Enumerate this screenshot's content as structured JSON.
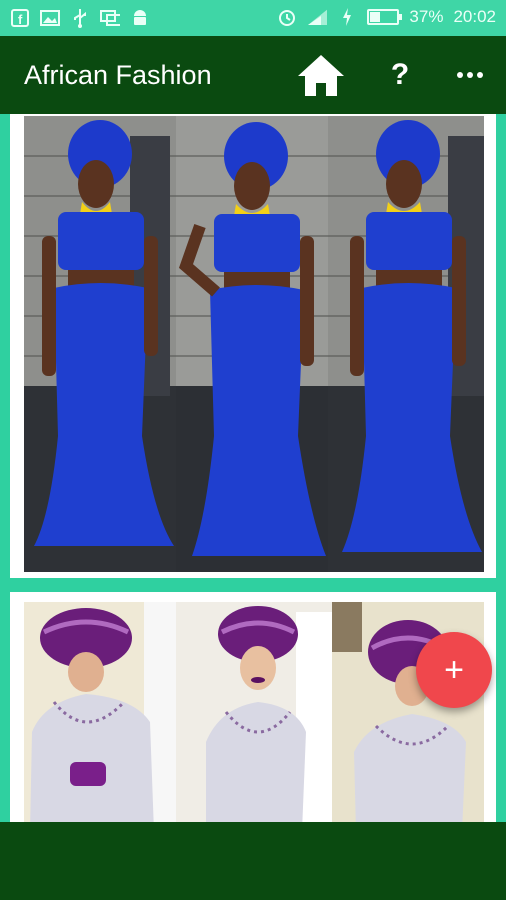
{
  "status_bar": {
    "battery_percent_text": "37%",
    "battery_level": 0.37,
    "time": "20:02"
  },
  "app_bar": {
    "title": "African Fashion",
    "help_label": "?",
    "icons": [
      "home-icon",
      "overflow-menu-icon"
    ]
  },
  "fab": {
    "label": "+"
  },
  "colors": {
    "status_bar": "#3fd6a6",
    "app_bar": "#0a4a10",
    "content_bg": "#2fd0a0",
    "fab": "#f0474c",
    "outfit_1": "#1f3fcf",
    "outfit_2": "#d8d8e4",
    "gele_2": "#6a1e7a"
  }
}
